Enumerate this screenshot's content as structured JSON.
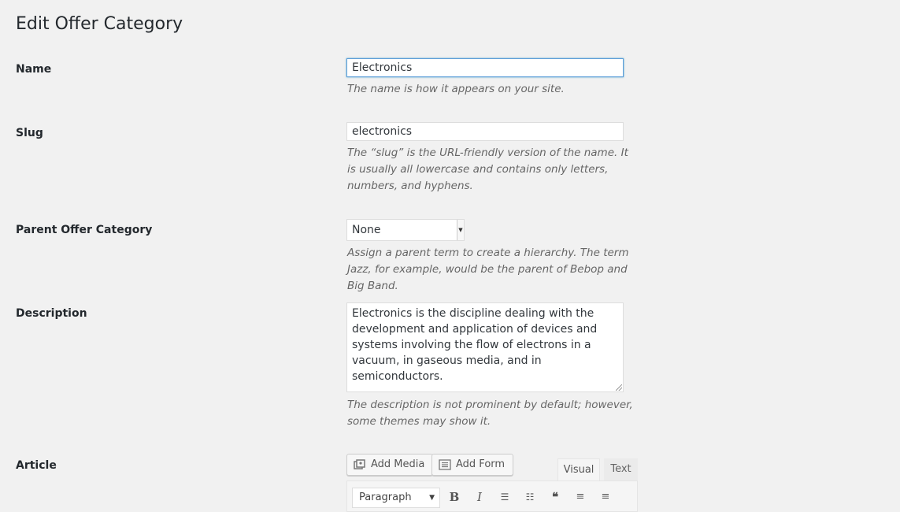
{
  "page": {
    "title": "Edit Offer Category"
  },
  "form": {
    "name": {
      "label": "Name",
      "value": "Electronics",
      "hint": "The name is how it appears on your site."
    },
    "slug": {
      "label": "Slug",
      "value": "electronics",
      "hint": "The “slug” is the URL-friendly version of the name. It is usually all lowercase and contains only letters, numbers, and hyphens."
    },
    "parent": {
      "label": "Parent Offer Category",
      "selected": "None",
      "hint": "Assign a parent term to create a hierarchy. The term Jazz, for example, would be the parent of Bebop and Big Band."
    },
    "description": {
      "label": "Description",
      "value": "Electronics is the discipline dealing with the development and application of devices and systems involving the flow of electrons in a vacuum, in gaseous media, and in semiconductors.",
      "hint": "The description is not prominent by default; however, some themes may show it."
    },
    "article": {
      "label": "Article",
      "add_media": "Add Media",
      "add_form": "Add Form",
      "tab_visual": "Visual",
      "tab_text": "Text",
      "format": "Paragraph",
      "toolbar_icons": [
        "bold-icon",
        "italic-icon",
        "bullet-list-icon",
        "numbered-list-icon",
        "blockquote-icon",
        "align-left-icon",
        "align-center-icon"
      ]
    }
  }
}
